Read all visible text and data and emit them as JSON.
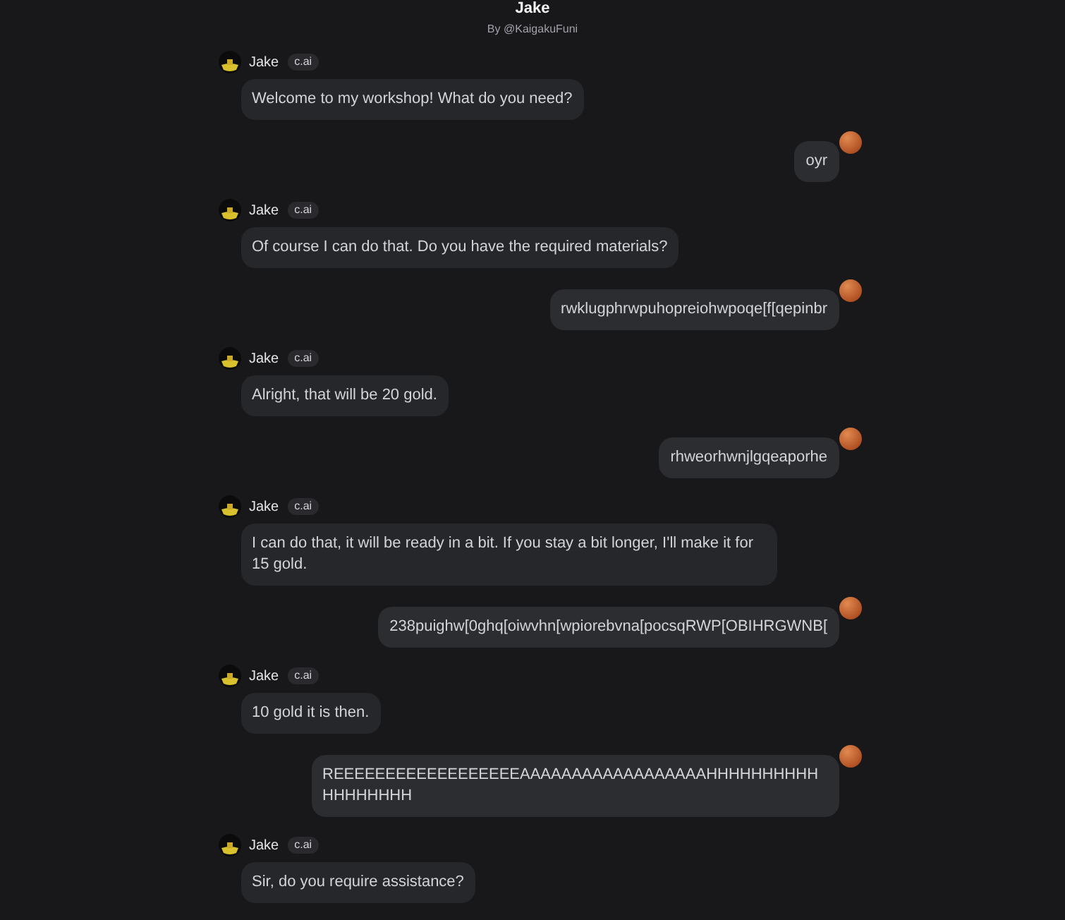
{
  "header": {
    "title": "Jake",
    "subtitle": "By @KaigakuFuni"
  },
  "messages": [
    {
      "kind": "bot",
      "name": "Jake",
      "tag": "c.ai",
      "text": "Welcome to my workshop! What do you need?"
    },
    {
      "kind": "user",
      "text": "oyr"
    },
    {
      "kind": "bot",
      "name": "Jake",
      "tag": "c.ai",
      "text": "Of course I can do that. Do you have the required materials?"
    },
    {
      "kind": "user",
      "text": "rwklugphrwpuhopreiohwpoqe[f[qepinbr"
    },
    {
      "kind": "bot",
      "name": "Jake",
      "tag": "c.ai",
      "text": "Alright, that will be 20 gold."
    },
    {
      "kind": "user",
      "text": "rhweorhwnjlgqeaporhe"
    },
    {
      "kind": "bot",
      "name": "Jake",
      "tag": "c.ai",
      "text": "I can do that, it will be ready in a bit. If you stay a bit longer, I'll make it for 15 gold."
    },
    {
      "kind": "user",
      "text": "238puighw[0ghq[oiwvhn[wpiorebvna[pocsqRWP[OBIHRGWNB["
    },
    {
      "kind": "bot",
      "name": "Jake",
      "tag": "c.ai",
      "text": "10 gold it is then."
    },
    {
      "kind": "user",
      "text": "REEEEEEEEEEEEEEEEEEAAAAAAAAAAAAAAAAAAHHHHHHHHHHHHHHHHHH"
    },
    {
      "kind": "bot",
      "name": "Jake",
      "tag": "c.ai",
      "text": "Sir, do you require assistance?"
    }
  ]
}
